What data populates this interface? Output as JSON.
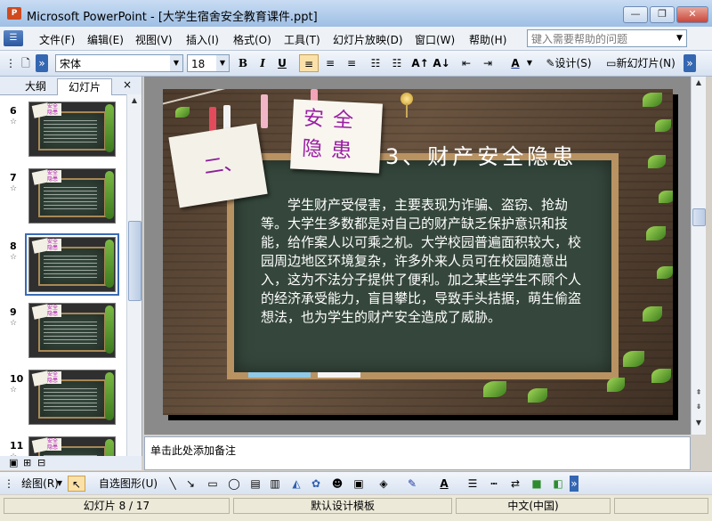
{
  "window": {
    "title": "Microsoft PowerPoint - [大学生宿舍安全教育课件.ppt]",
    "app_icon": "powerpoint-icon",
    "minimize_label": "—",
    "maximize_label": "❐",
    "close_label": "✕"
  },
  "menu": {
    "items": [
      "文件(F)",
      "编辑(E)",
      "视图(V)",
      "插入(I)",
      "格式(O)",
      "工具(T)",
      "幻灯片放映(D)",
      "窗口(W)",
      "帮助(H)"
    ],
    "help_placeholder": "键入需要帮助的问题"
  },
  "toolbar": {
    "font_name": "宋体",
    "font_size": "18",
    "bold": "B",
    "italic": "I",
    "underline": "U",
    "font_color_label": "A",
    "design_label": "设计(S)",
    "new_slide_label": "新幻灯片(N)"
  },
  "side_panel": {
    "tabs": [
      "大纲",
      "幻灯片"
    ],
    "active_tab": "幻灯片",
    "close_label": "×",
    "thumbnails": [
      {
        "number": "6",
        "selected": false
      },
      {
        "number": "7",
        "selected": false
      },
      {
        "number": "8",
        "selected": true
      },
      {
        "number": "9",
        "selected": false
      },
      {
        "number": "10",
        "selected": false
      },
      {
        "number": "11",
        "selected": false
      }
    ],
    "thumb_note_text": "安全隐患"
  },
  "slide": {
    "card_left": "二、",
    "card_right": "安全隐患",
    "heading": "3、财产安全隐患",
    "body": "学生财产受侵害，主要表现为诈骗、盗窃、抢劫等。大学生多数都是对自己的财产缺乏保护意识和技能，给作案人以可乘之机。大学校园普遍面积较大，校园周边地区环境复杂，许多外来人员可在校园随意出入，这为不法分子提供了便利。加之某些学生不顾个人的经济承受能力，盲目攀比，导致手头拮据，萌生偷盗想法，也为学生的财产安全造成了威胁。"
  },
  "notes": {
    "placeholder": "单击此处添加备注"
  },
  "drawing_toolbar": {
    "draw_label": "绘图(R)",
    "autoshapes_label": "自选图形(U)"
  },
  "status": {
    "slide_position": "幻灯片 8 / 17",
    "template": "默认设计模板",
    "language": "中文(中国)"
  },
  "colors": {
    "title_accent": "#9b1fa5",
    "board": "#35473c",
    "frame": "#b99262",
    "selection": "#3b6bb4"
  }
}
